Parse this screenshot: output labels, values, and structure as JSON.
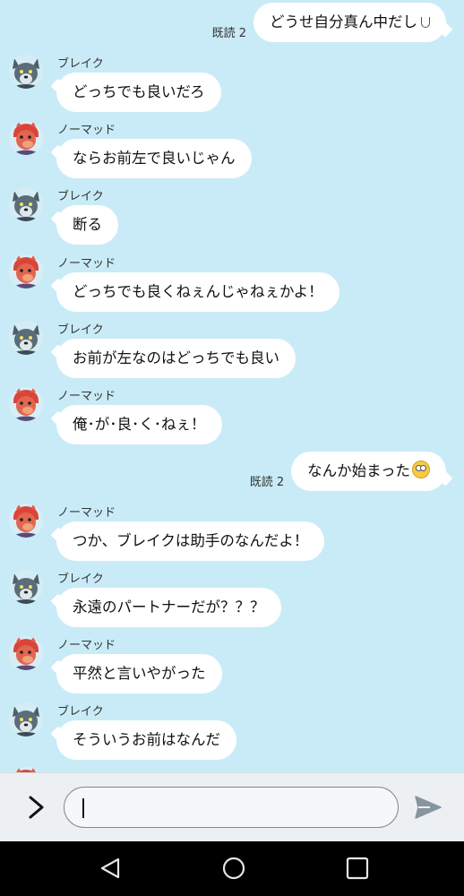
{
  "out_messages": [
    {
      "text": "どうせ自分真ん中だし",
      "read": "既読 2"
    },
    {
      "text": "なんか始まった",
      "read": "既読 2"
    }
  ],
  "in_messages": [
    {
      "sender": "ブレイク",
      "text": "どっちでも良いだろ"
    },
    {
      "sender": "ノーマッド",
      "text": "ならお前左で良いじゃん"
    },
    {
      "sender": "ブレイク",
      "text": "断る"
    },
    {
      "sender": "ノーマッド",
      "text": "どっちでも良くねぇんじゃねぇかよ！"
    },
    {
      "sender": "ブレイク",
      "text": "お前が左なのはどっちでも良い"
    },
    {
      "sender": "ノーマッド",
      "text": "俺･が･良･く･ねぇ！"
    },
    {
      "sender": "ノーマッド",
      "text": "つか、ブレイクは助手のなんだよ！"
    },
    {
      "sender": "ブレイク",
      "text": "永遠のパートナーだが？？？"
    },
    {
      "sender": "ノーマッド",
      "text": "平然と言いやがった"
    },
    {
      "sender": "ブレイク",
      "text": "そういうお前はなんだ"
    }
  ],
  "input": {
    "value": "",
    "placeholder": ""
  },
  "icons": {
    "expand": "chevron-right-icon",
    "send": "send-icon",
    "nav_back": "back-triangle-icon",
    "nav_home": "home-circle-icon",
    "nav_recent": "recent-square-icon"
  },
  "colors": {
    "background": "#c9ebf7",
    "bubble": "#ffffff",
    "wolf_avatar": "#5b6d78",
    "red_avatar": "#d9453a"
  }
}
